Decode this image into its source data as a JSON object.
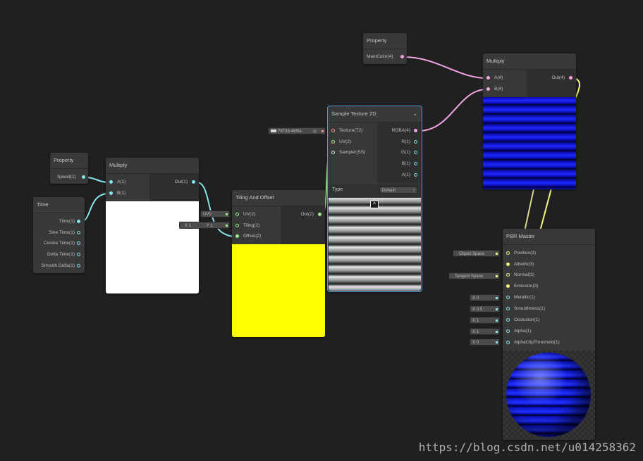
{
  "colors": {
    "background": "#202020",
    "node": "#393939",
    "vector1": "#84e4e7",
    "vector2": "#9bf08a",
    "vector4": "#f5a3e6",
    "vector3": "#f5f57a",
    "selection": "#44a0d8"
  },
  "property_maincolor": {
    "title": "Property",
    "output": "MainColor(4)"
  },
  "property_speed": {
    "title": "Property",
    "output": "Speed(1)"
  },
  "time": {
    "title": "Time",
    "outputs": [
      "Time(1)",
      "Sine Time(1)",
      "Cosine Time(1)",
      "Delta Time(1)",
      "Smooth Delta(1)"
    ]
  },
  "multiply1": {
    "title": "Multiply",
    "inputs": [
      "A(1)",
      "B(1)"
    ],
    "output": "Out(1)"
  },
  "tiling": {
    "title": "Tiling And Offset",
    "inputs": [
      "UV(2)",
      "Tiling(2)",
      "Offset(2)"
    ],
    "output": "Out(2)",
    "uv_value": "UV0",
    "tiling_x": "X 1",
    "tiling_y": "Y 1"
  },
  "sample": {
    "title": "Sample Texture 2D",
    "inputs": [
      "Texture(T2)",
      "UV(2)",
      "Sampler(SS)"
    ],
    "outputs": [
      "RGBA(4)",
      "R(1)",
      "G(1)",
      "B(1)",
      "A(1)"
    ],
    "type_label": "Type",
    "type_value": "Default",
    "texture_value": "78733-46f0e"
  },
  "multiply2": {
    "title": "Multiply",
    "inputs": [
      "A(4)",
      "B(4)"
    ],
    "output": "Out(4)"
  },
  "pbr": {
    "title": "PBR Master",
    "inputs": [
      "Position(3)",
      "Albedo(3)",
      "Normal(3)",
      "Emission(3)",
      "Metallic(1)",
      "Smoothness(1)",
      "Occlusion(1)",
      "Alpha(1)",
      "AlphaClipThreshold(1)"
    ],
    "position_space": "Object Space",
    "normal_space": "Tangent Space",
    "defaults": [
      "X 0",
      "X 0.5",
      "X 1",
      "X 1",
      "X 0"
    ]
  },
  "watermark": "https://blog.csdn.net/u014258362"
}
